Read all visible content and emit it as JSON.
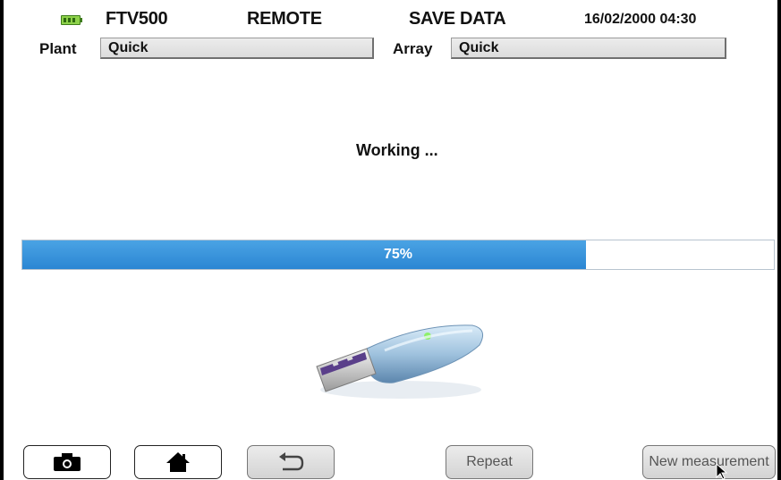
{
  "header": {
    "device": "FTV500",
    "mode": "REMOTE",
    "action": "SAVE DATA",
    "datetime": "16/02/2000 04:30"
  },
  "selection": {
    "plant_label": "Plant",
    "plant_value": "Quick",
    "array_label": "Array",
    "array_value": "Quick"
  },
  "status": {
    "message": "Working ...",
    "progress_percent": 75,
    "progress_label": "75%"
  },
  "toolbar": {
    "camera_icon": "camera-icon",
    "home_icon": "home-icon",
    "back_icon": "back-arrow-icon",
    "repeat_label": "Repeat",
    "new_measurement_label": "New measurement"
  },
  "colors": {
    "progress_fill": "#2b86d3",
    "battery": "#8ed24a"
  }
}
